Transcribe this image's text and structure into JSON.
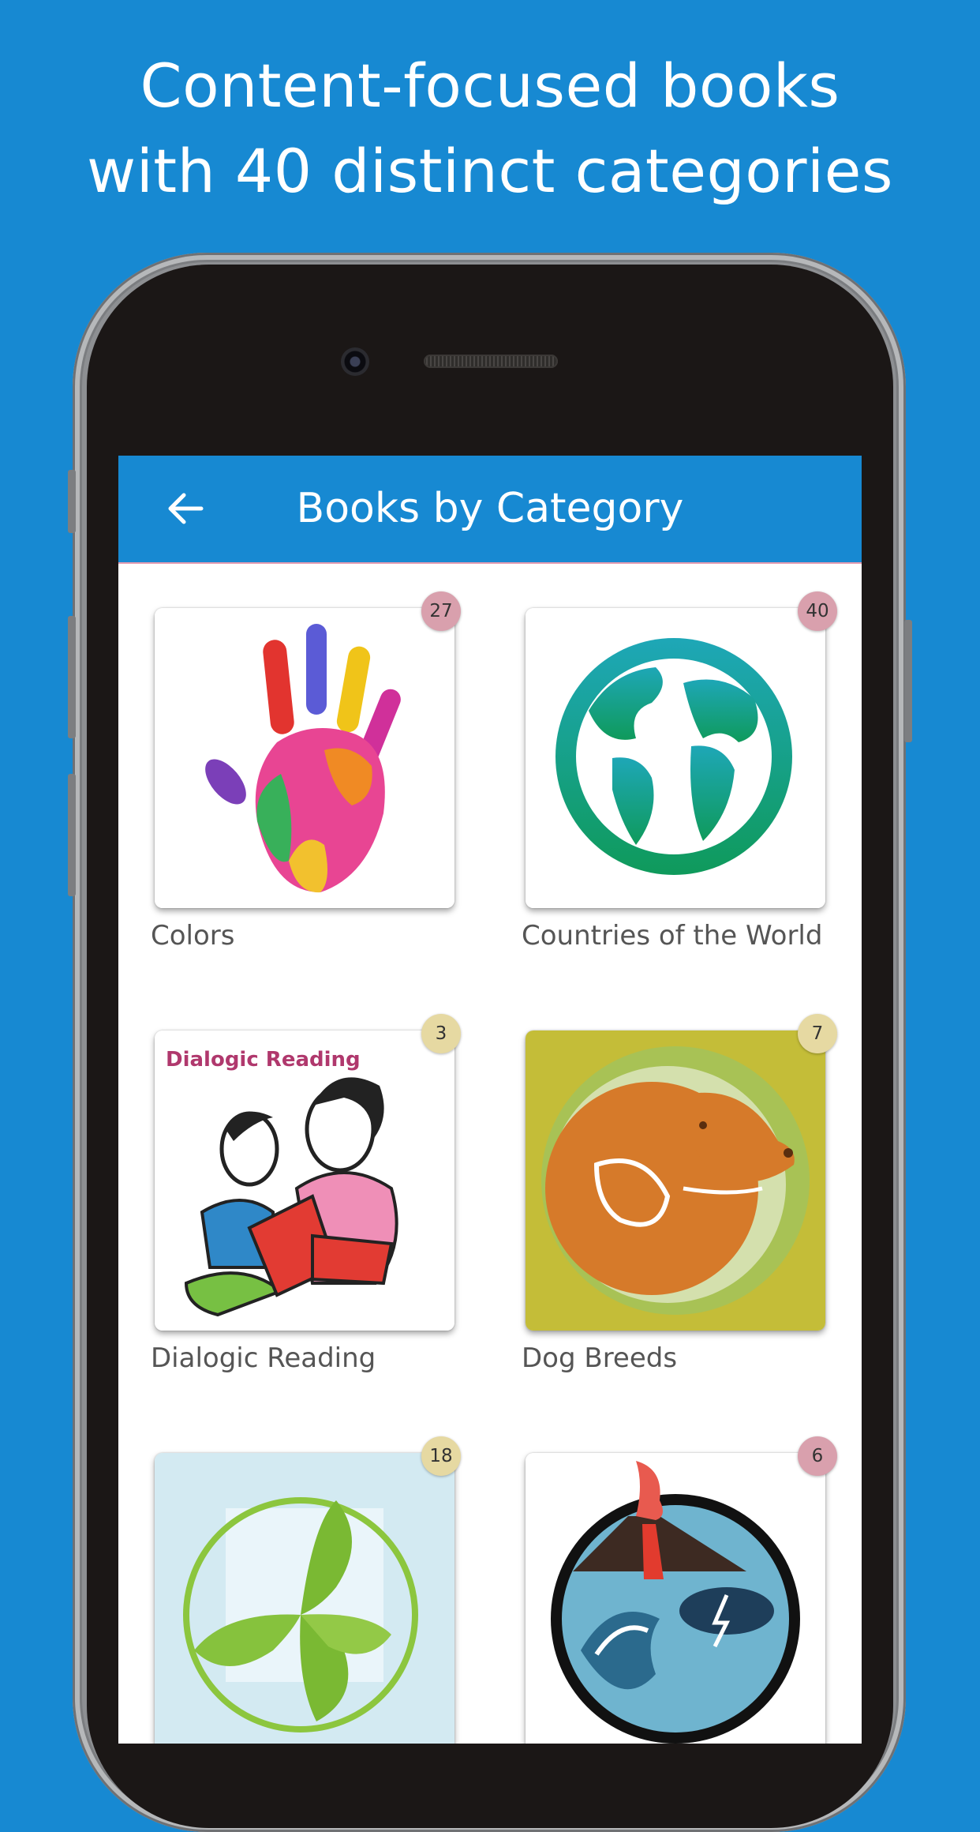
{
  "headline": {
    "line1": "Content-focused books",
    "line2": "with 40 distinct categories"
  },
  "appbar": {
    "title": "Books by Category",
    "back_icon": "arrow-left-icon"
  },
  "categories": [
    {
      "label": "Colors",
      "count": "27",
      "badge_color": "#d9a0ad",
      "icon": "painted-hand-icon"
    },
    {
      "label": "Countries of the World",
      "count": "40",
      "badge_color": "#d9a0ad",
      "icon": "globe-icon"
    },
    {
      "label": "Dialogic Reading",
      "count": "3",
      "badge_color": "#e6d9a2",
      "icon": "mother-child-reading-icon",
      "image_text": "Dialogic Reading"
    },
    {
      "label": "Dog Breeds",
      "count": "7",
      "badge_color": "#e6d9a2",
      "icon": "dog-head-icon"
    },
    {
      "label": "",
      "count": "18",
      "badge_color": "#e6d9a2",
      "icon": "recycle-leaves-icon"
    },
    {
      "label": "",
      "count": "6",
      "badge_color": "#d9a0ad",
      "icon": "natural-disasters-icon"
    }
  ],
  "colors": {
    "background": "#1789d2",
    "appbar": "#1789d2",
    "badge_pink": "#d9a0ad",
    "badge_yellow": "#e6d9a2"
  }
}
